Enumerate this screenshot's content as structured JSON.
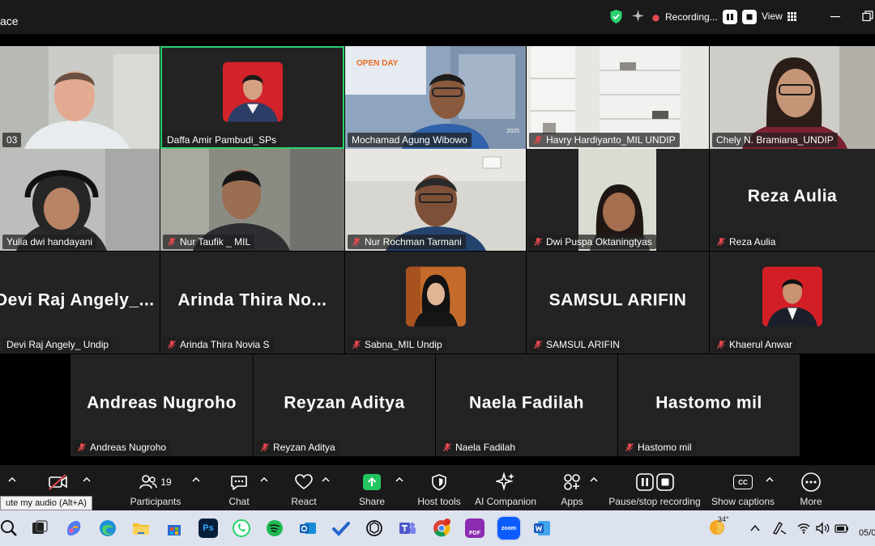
{
  "window": {
    "title_fragment": "ace",
    "recording_label": "Recording...",
    "view_label": "View"
  },
  "tiles": [
    {
      "name": "03"
    },
    {
      "name": "Daffa Amir Pambudi_SPs"
    },
    {
      "name": "Mochamad Agung Wibowo"
    },
    {
      "name": "Havry Hardiyanto_MIL UNDIP"
    },
    {
      "name": "Chely N. Bramiana_UNDIP"
    },
    {
      "name": "Yulia dwi handayani"
    },
    {
      "name": "Nur Taufik _ MIL"
    },
    {
      "name": "Nur Rochman Tarmani"
    },
    {
      "name": "Dwi Puspa Oktaningtyas"
    },
    {
      "name": "Reza Aulia",
      "big": "Reza Aulia"
    },
    {
      "name": "Devi Raj Angely_ Undip",
      "big": "Devi Raj Angely_..."
    },
    {
      "name": "Arinda Thira Novia S",
      "big": "Arinda Thira No..."
    },
    {
      "name": "Sabna_MIL Undip"
    },
    {
      "name": "SAMSUL ARIFIN",
      "big": "SAMSUL ARIFIN"
    },
    {
      "name": "Khaerul Anwar"
    },
    {
      "name": "Andreas Nugroho",
      "big": "Andreas Nugroho"
    },
    {
      "name": "Reyzan Aditya",
      "big": "Reyzan Aditya"
    },
    {
      "name": "Naela Fadilah",
      "big": "Naela Fadilah"
    },
    {
      "name": "Hastomo mil",
      "big": "Hastomo mil"
    }
  ],
  "slide": {
    "headline": "OPEN DAY",
    "year": "2025"
  },
  "toolbar": {
    "participants_count": "19",
    "participants": "Participants",
    "chat": "Chat",
    "react": "React",
    "share": "Share",
    "host_tools": "Host tools",
    "ai_companion": "AI Companion",
    "apps": "Apps",
    "recording": "Pause/stop recording",
    "captions": "Show captions",
    "captions_icon": "CC",
    "more": "More",
    "tooltip": "ute my audio (Alt+A)"
  },
  "taskbar": {
    "temperature": "34°",
    "date_fragment": "05/0",
    "photoshop": "Ps",
    "pdf": "PDF",
    "zoom": "zoom"
  },
  "colors": {
    "active_speaker": "#2bd26e",
    "share_green": "#23c55e",
    "mute_red": "#e5484d"
  }
}
